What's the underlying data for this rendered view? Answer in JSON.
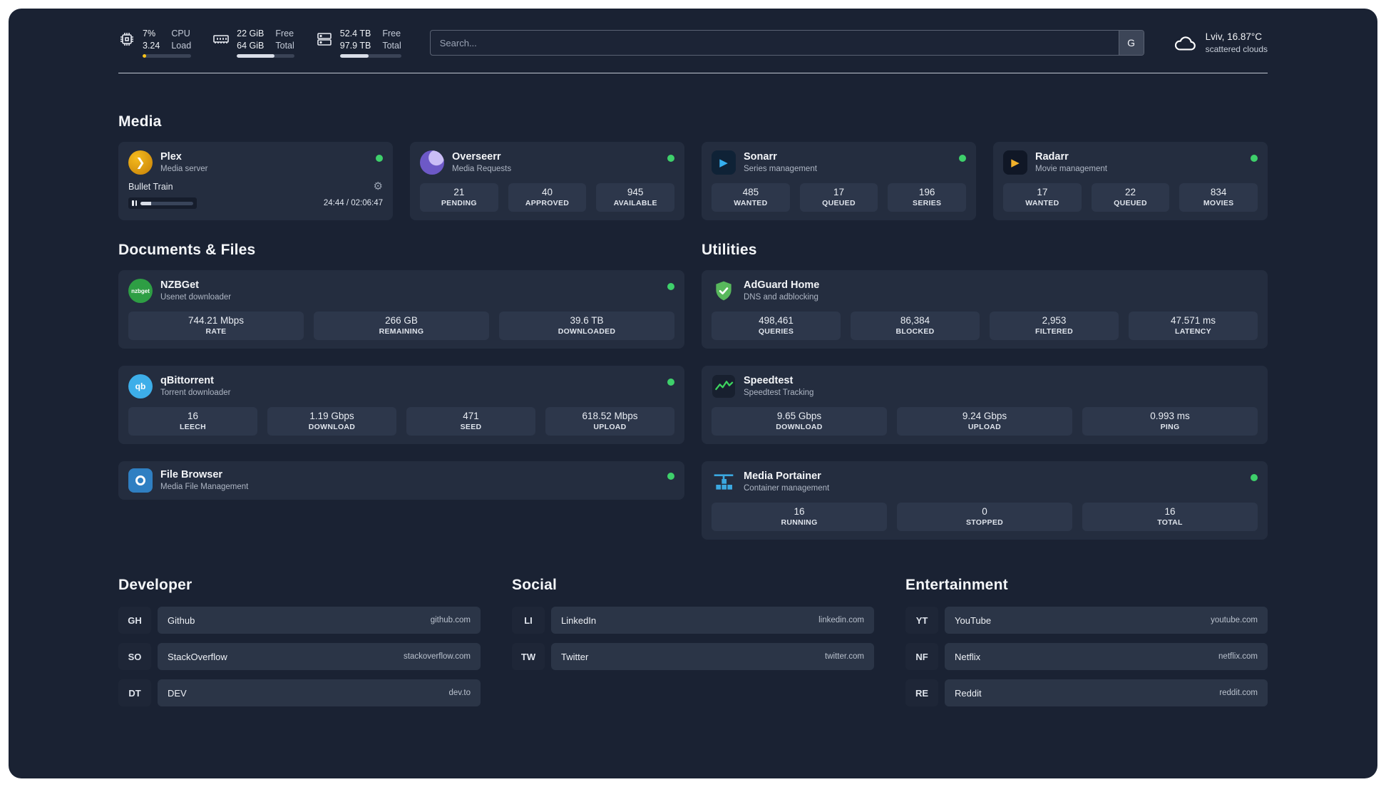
{
  "topbar": {
    "cpu": {
      "value_top": "7%",
      "value_bottom": "3.24",
      "label_top": "CPU",
      "label_bottom": "Load",
      "bar_pct": 7
    },
    "ram": {
      "value_top": "22 GiB",
      "value_bottom": "64 GiB",
      "label_top": "Free",
      "label_bottom": "Total",
      "bar_pct": 66
    },
    "disk": {
      "value_top": "52.4 TB",
      "value_bottom": "97.9 TB",
      "label_top": "Free",
      "label_bottom": "Total",
      "bar_pct": 47
    },
    "search": {
      "placeholder": "Search...",
      "engine_button": "G"
    },
    "weather": {
      "location": "Lviv, 16.87°C",
      "condition": "scattered clouds"
    }
  },
  "sections": {
    "media": "Media",
    "documents": "Documents & Files",
    "utilities": "Utilities",
    "developer": "Developer",
    "social": "Social",
    "entertainment": "Entertainment"
  },
  "media": {
    "plex": {
      "title": "Plex",
      "subtitle": "Media server",
      "now_playing": "Bullet Train",
      "time": "24:44 / 02:06:47",
      "progress_pct": 20
    },
    "overseerr": {
      "title": "Overseerr",
      "subtitle": "Media Requests",
      "stats": [
        {
          "value": "21",
          "label": "PENDING"
        },
        {
          "value": "40",
          "label": "APPROVED"
        },
        {
          "value": "945",
          "label": "AVAILABLE"
        }
      ]
    },
    "sonarr": {
      "title": "Sonarr",
      "subtitle": "Series management",
      "stats": [
        {
          "value": "485",
          "label": "WANTED"
        },
        {
          "value": "17",
          "label": "QUEUED"
        },
        {
          "value": "196",
          "label": "SERIES"
        }
      ]
    },
    "radarr": {
      "title": "Radarr",
      "subtitle": "Movie management",
      "stats": [
        {
          "value": "17",
          "label": "WANTED"
        },
        {
          "value": "22",
          "label": "QUEUED"
        },
        {
          "value": "834",
          "label": "MOVIES"
        }
      ]
    }
  },
  "documents": {
    "nzbget": {
      "title": "NZBGet",
      "subtitle": "Usenet downloader",
      "icon_text": "nzbget",
      "stats": [
        {
          "value": "744.21 Mbps",
          "label": "RATE"
        },
        {
          "value": "266 GB",
          "label": "REMAINING"
        },
        {
          "value": "39.6 TB",
          "label": "DOWNLOADED"
        }
      ]
    },
    "qbittorrent": {
      "title": "qBittorrent",
      "subtitle": "Torrent downloader",
      "icon_text": "qb",
      "stats": [
        {
          "value": "16",
          "label": "LEECH"
        },
        {
          "value": "1.19 Gbps",
          "label": "DOWNLOAD"
        },
        {
          "value": "471",
          "label": "SEED"
        },
        {
          "value": "618.52 Mbps",
          "label": "UPLOAD"
        }
      ]
    },
    "filebrowser": {
      "title": "File Browser",
      "subtitle": "Media File Management"
    }
  },
  "utilities": {
    "adguard": {
      "title": "AdGuard Home",
      "subtitle": "DNS and adblocking",
      "stats": [
        {
          "value": "498,461",
          "label": "QUERIES"
        },
        {
          "value": "86,384",
          "label": "BLOCKED"
        },
        {
          "value": "2,953",
          "label": "FILTERED"
        },
        {
          "value": "47.571 ms",
          "label": "LATENCY"
        }
      ]
    },
    "speedtest": {
      "title": "Speedtest",
      "subtitle": "Speedtest Tracking",
      "stats": [
        {
          "value": "9.65 Gbps",
          "label": "DOWNLOAD"
        },
        {
          "value": "9.24 Gbps",
          "label": "UPLOAD"
        },
        {
          "value": "0.993 ms",
          "label": "PING"
        }
      ]
    },
    "portainer": {
      "title": "Media Portainer",
      "subtitle": "Container management",
      "stats": [
        {
          "value": "16",
          "label": "RUNNING"
        },
        {
          "value": "0",
          "label": "STOPPED"
        },
        {
          "value": "16",
          "label": "TOTAL"
        }
      ]
    }
  },
  "links": {
    "developer": [
      {
        "abbr": "GH",
        "name": "Github",
        "domain": "github.com"
      },
      {
        "abbr": "SO",
        "name": "StackOverflow",
        "domain": "stackoverflow.com"
      },
      {
        "abbr": "DT",
        "name": "DEV",
        "domain": "dev.to"
      }
    ],
    "social": [
      {
        "abbr": "LI",
        "name": "LinkedIn",
        "domain": "linkedin.com"
      },
      {
        "abbr": "TW",
        "name": "Twitter",
        "domain": "twitter.com"
      }
    ],
    "entertainment": [
      {
        "abbr": "YT",
        "name": "YouTube",
        "domain": "youtube.com"
      },
      {
        "abbr": "NF",
        "name": "Netflix",
        "domain": "netflix.com"
      },
      {
        "abbr": "RE",
        "name": "Reddit",
        "domain": "reddit.com"
      }
    ]
  },
  "colors": {
    "status_ok": "#3ed06b",
    "cpu_bar": "#fcc419",
    "background": "#1a2233",
    "card": "#242d3f",
    "stat_box": "#2d374b"
  }
}
